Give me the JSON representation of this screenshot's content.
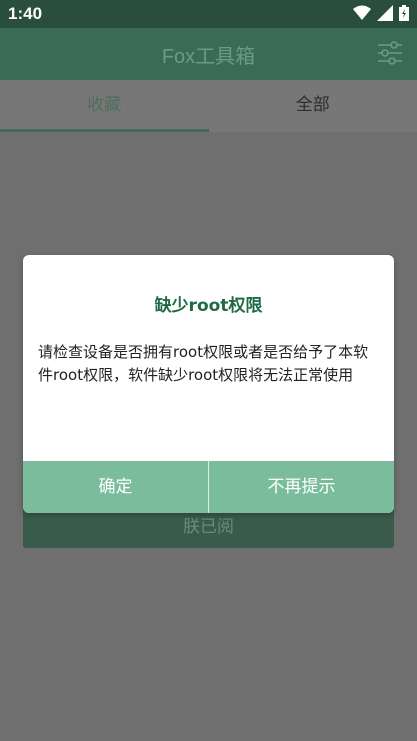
{
  "status_bar": {
    "time": "1:40",
    "icons": [
      "wifi-icon",
      "signal-icon",
      "battery-icon"
    ]
  },
  "app_bar": {
    "title": "Fox工具箱",
    "settings_icon": "sliders-icon"
  },
  "tabs": [
    {
      "label": "收藏",
      "active": true
    },
    {
      "label": "全部",
      "active": false
    }
  ],
  "background": {
    "button_label": "朕已阅"
  },
  "dialog": {
    "title": "缺少root权限",
    "message": "请检查设备是否拥有root权限或者是否给予了本软件root权限，软件缺少root权限将无法正常使用",
    "buttons": {
      "confirm": "确定",
      "dont_show": "不再提示"
    }
  },
  "colors": {
    "accent": "#3c6b55",
    "dialog_button": "#7bbd9a",
    "dialog_title": "#1f6b45"
  }
}
